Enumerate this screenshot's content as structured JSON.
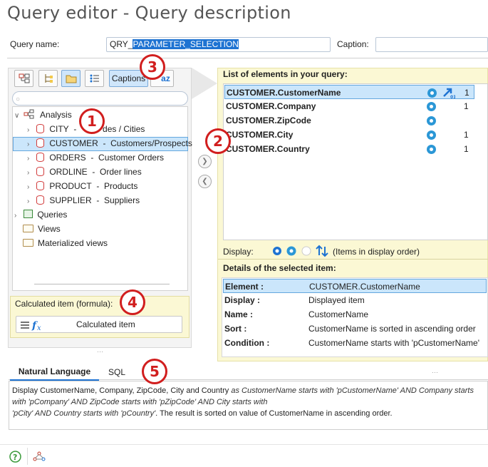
{
  "window": {
    "title": "Query editor - Query description"
  },
  "header": {
    "query_name_label": "Query name:",
    "query_name_value": "QRY_PARAMETER_SELECTION",
    "query_name_prefix": "QRY_",
    "query_name_selected": "PARAMETER_SELECTION",
    "caption_label": "Caption:",
    "caption_value": ""
  },
  "toolbar": {
    "captions_label": "Captions",
    "az_label": "az"
  },
  "search": {
    "placeholder": ""
  },
  "tree": {
    "root": "Analysis",
    "tables": [
      {
        "name": "CITY",
        "caption": "Zip codes / Cities",
        "visible_caption": "des / Cities"
      },
      {
        "name": "CUSTOMER",
        "caption": "Customers/Prospects"
      },
      {
        "name": "ORDERS",
        "caption": "Customer Orders"
      },
      {
        "name": "ORDLINE",
        "caption": "Order lines"
      },
      {
        "name": "PRODUCT",
        "caption": "Products"
      },
      {
        "name": "SUPPLIER",
        "caption": "Suppliers"
      }
    ],
    "queries": "Queries",
    "views": "Views",
    "materialized_views": "Materialized views"
  },
  "calculated": {
    "title": "Calculated item (formula):",
    "button_label": "Calculated item"
  },
  "elements": {
    "title": "List of elements in your query:",
    "items": [
      {
        "name": "CUSTOMER.CustomerName",
        "sort": "1"
      },
      {
        "name": "CUSTOMER.Company",
        "sort": "1"
      },
      {
        "name": "CUSTOMER.ZipCode",
        "sort": ""
      },
      {
        "name": "CUSTOMER.City",
        "sort": "1"
      },
      {
        "name": "CUSTOMER.Country",
        "sort": "1"
      }
    ],
    "display_label": "Display:",
    "display_order_text": "(Items in display order)"
  },
  "details": {
    "title": "Details of the selected item:",
    "rows": [
      {
        "key": "Element :",
        "value": "CUSTOMER.CustomerName"
      },
      {
        "key": "Display :",
        "value": "Displayed item"
      },
      {
        "key": "Name :",
        "value": "CustomerName"
      },
      {
        "key": "Sort :",
        "value": "CustomerName is sorted in ascending order"
      },
      {
        "key": "Condition :",
        "value": "CustomerName  starts with 'pCustomerName'"
      }
    ]
  },
  "bottom_tabs": {
    "natural_language": "Natural Language",
    "sql": "SQL"
  },
  "natural_language": {
    "prefix": "Display",
    "fields": " CustomerName, Company, ZipCode, City and Country ",
    "condition": "as CustomerName  starts with 'pCustomerName' AND Company  starts with 'pCompany' AND ZipCode  starts with 'pZipCode' AND City  starts with",
    "condition2": "'pCity' AND Country  starts with 'pCountry'",
    "suffix": ". The result is sorted on value of CustomerName in ascending order."
  },
  "annotations": [
    "1",
    "2",
    "3",
    "4",
    "5"
  ],
  "colors": {
    "accent": "#1e73d2",
    "selection": "#cbe6fb",
    "panel_yellow": "#fbf8d4",
    "badge_red": "#d11e1e"
  }
}
